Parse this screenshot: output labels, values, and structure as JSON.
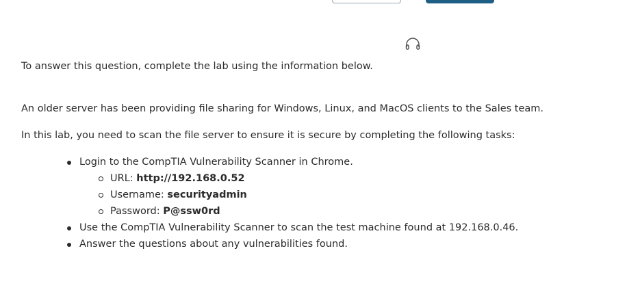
{
  "lab": {
    "intro": "To answer this question, complete the lab using the information below.",
    "description": "An older server has been providing file sharing for Windows, Linux, and MacOS clients to the Sales team.",
    "task_intro": "In this lab, you need to scan the file server to ensure it is secure by completing the following tasks:",
    "tasks": {
      "login": "Login to the CompTIA Vulnerability Scanner in Chrome.",
      "url_label": "URL: ",
      "url_value": "http://192.168.0.52",
      "username_label": "Username: ",
      "username_value": "securityadmin",
      "password_label": "Password: ",
      "password_value": "P@ssw0rd",
      "scan": "Use the CompTIA Vulnerability Scanner to scan the test machine found at 192.168.0.46.",
      "answer": "Answer the questions about any vulnerabilities found."
    }
  },
  "icons": {
    "audio": "headphones-icon"
  },
  "colors": {
    "primary_button": "#1f5f86",
    "outline_button_border": "#9aa7b4",
    "text": "#2b2b2b"
  }
}
